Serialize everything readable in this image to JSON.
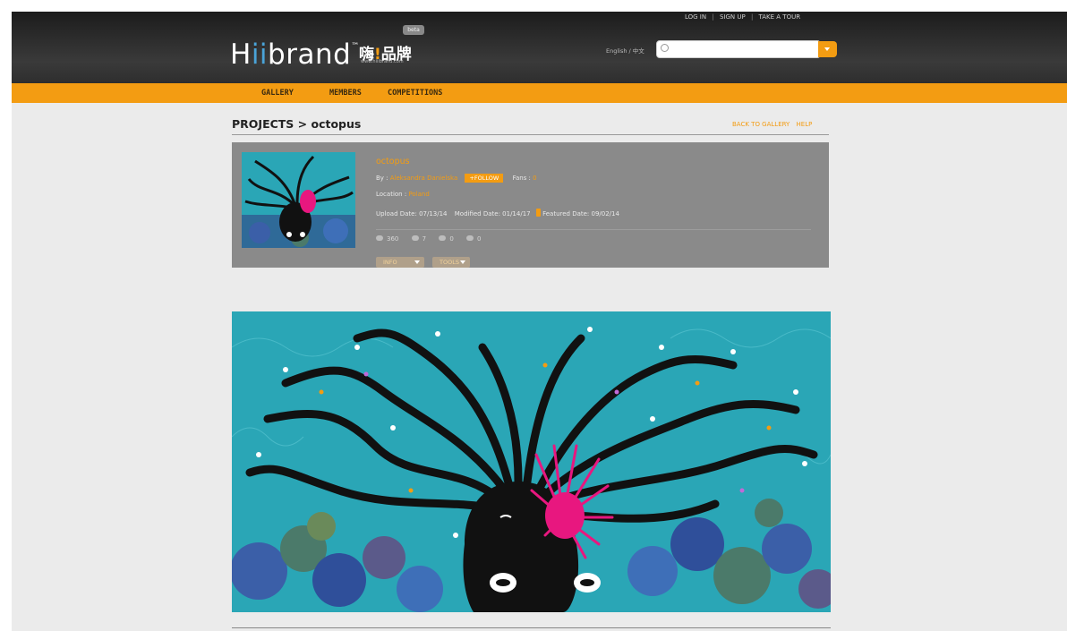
{
  "header": {
    "logo_text_h": "H",
    "logo_text_ii": "ii",
    "logo_text_brand": "brand",
    "logo_tm": "™",
    "logo_cn_1": "嗨",
    "logo_cn_ex": "!",
    "logo_cn_2": "品牌",
    "logo_url": "www.hiiibrand.com",
    "beta": "beta",
    "top_links": {
      "login": "LOG IN",
      "signup": "SIGN UP",
      "tour": "TAKE A TOUR",
      "sep": "|"
    },
    "language": "English / 中文",
    "search_placeholder": ""
  },
  "nav": {
    "gallery": "GALLERY",
    "members": "MEMBERS",
    "competitions": "COMPETITIONS"
  },
  "breadcrumb": {
    "text": "PROJECTS > octopus",
    "back": "BACK TO GALLERY",
    "help": "HELP"
  },
  "project": {
    "title": "octopus",
    "by_label": "By :",
    "author": "Aleksandra Danielska",
    "follow": "+FOLLOW",
    "fans_label": "Fans :",
    "fans": "0",
    "location_label": "Location :",
    "location": "Poland",
    "upload": "Upload Date: 07/13/14",
    "modified": "Modified Date: 01/14/17",
    "featured": "Featured Date: 09/02/14",
    "stats": {
      "views": "360",
      "likes": "7",
      "comments": "0",
      "favorites": "0"
    },
    "dropdown1": "INFO",
    "dropdown2": "TOOLS"
  },
  "colors": {
    "accent": "#f39c12",
    "header": "#2a2a2a",
    "panel": "#8a8a8a",
    "sea": "#2aa6b6",
    "pink": "#e8177f"
  }
}
